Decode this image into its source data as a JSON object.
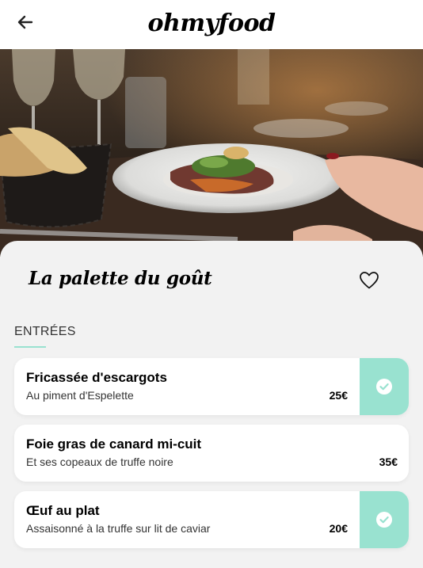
{
  "header": {
    "logo": "ohmyfood"
  },
  "restaurant": {
    "name": "La palette du goût"
  },
  "menu": {
    "section_title": "ENTRÉES",
    "items": [
      {
        "name": "Fricassée d'escargots",
        "description": "Au piment d'Espelette",
        "price": "25€",
        "selected": true
      },
      {
        "name": "Foie gras de canard mi-cuit",
        "description": "Et ses copeaux de truffe noire",
        "price": "35€",
        "selected": false
      },
      {
        "name": "Œuf au plat",
        "description": "Assaisonné à la truffe sur lit de caviar",
        "price": "20€",
        "selected": true
      }
    ]
  },
  "colors": {
    "accent": "#99e2d0",
    "background": "#f2f2f2",
    "card": "#ffffff"
  }
}
